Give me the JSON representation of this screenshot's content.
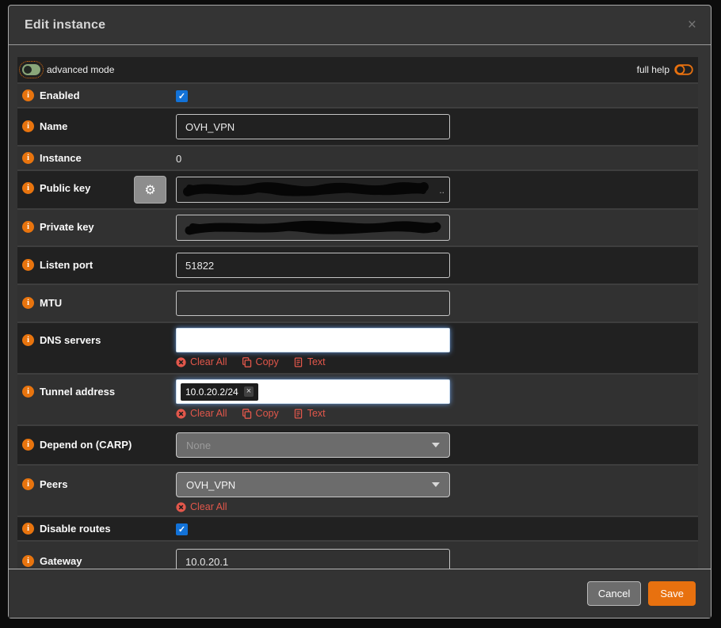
{
  "dialog": {
    "title": "Edit instance",
    "close_glyph": "×"
  },
  "toolbar": {
    "advanced_mode_label": "advanced mode",
    "full_help_label": "full help"
  },
  "icons": {
    "gear": "⚙",
    "check": "✓",
    "info": "i",
    "token_remove": "×",
    "caret": "css-triangle",
    "clear_all": "circle-x-icon",
    "copy": "copy-pages-icon",
    "text": "file-text-icon"
  },
  "colors": {
    "accent_orange": "#e8710f",
    "link_red": "#e2574b",
    "checkbox_blue": "#1272d8",
    "toggle_green": "#8aa77a"
  },
  "fields": {
    "enabled": {
      "label": "Enabled",
      "checked": true
    },
    "name": {
      "label": "Name",
      "value": "OVH_VPN"
    },
    "instance": {
      "label": "Instance",
      "value": "0"
    },
    "public_key": {
      "label": "Public key",
      "redacted": true,
      "overflow_hint": ".."
    },
    "private_key": {
      "label": "Private key",
      "redacted": true
    },
    "listen_port": {
      "label": "Listen port",
      "value": "51822"
    },
    "mtu": {
      "label": "MTU",
      "value": ""
    },
    "dns_servers": {
      "label": "DNS servers",
      "actions": {
        "clear": "Clear All",
        "copy": "Copy",
        "text": "Text"
      }
    },
    "tunnel_address": {
      "label": "Tunnel address",
      "token": "10.0.20.2/24",
      "actions": {
        "clear": "Clear All",
        "copy": "Copy",
        "text": "Text"
      }
    },
    "depend_carp": {
      "label": "Depend on (CARP)",
      "value": "None"
    },
    "peers": {
      "label": "Peers",
      "value": "OVH_VPN",
      "actions": {
        "clear": "Clear All"
      }
    },
    "disable_routes": {
      "label": "Disable routes",
      "checked": true
    },
    "gateway": {
      "label": "Gateway",
      "value": "10.0.20.1"
    }
  },
  "footer": {
    "cancel_label": "Cancel",
    "save_label": "Save"
  }
}
